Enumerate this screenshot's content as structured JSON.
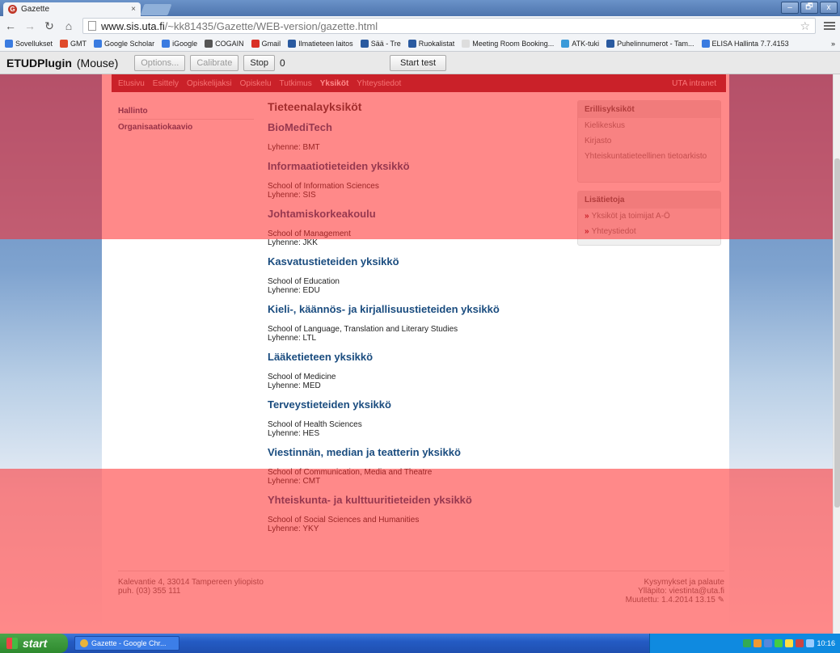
{
  "browser": {
    "tab_title": "Gazette",
    "tab_close": "×",
    "url_host": "www.sis.uta.fi",
    "url_path": "/~kk81435/Gazette/WEB-version/gazette.html",
    "window_controls": [
      "–",
      "🗗",
      "x"
    ]
  },
  "bookmarks": [
    {
      "label": "Sovellukset",
      "color": "#3a7be0"
    },
    {
      "label": "GMT",
      "color": "#e04a2a"
    },
    {
      "label": "Google Scholar",
      "color": "#3a7be0"
    },
    {
      "label": "iGoogle",
      "color": "#3a7be0"
    },
    {
      "label": "COGAIN",
      "color": "#555555"
    },
    {
      "label": "Gmail",
      "color": "#d93025"
    },
    {
      "label": "Ilmatieteen laitos",
      "color": "#2a5aa0"
    },
    {
      "label": "Sää - Tre",
      "color": "#2a5aa0"
    },
    {
      "label": "Ruokalistat",
      "color": "#2a5aa0"
    },
    {
      "label": "Meeting Room Booking...",
      "color": "#dddddd"
    },
    {
      "label": "ATK-tuki",
      "color": "#3a9ad9"
    },
    {
      "label": "Puhelinnumerot - Tam...",
      "color": "#2a5aa0"
    },
    {
      "label": "ELISA Hallinta 7.7.4153",
      "color": "#3a7be0"
    }
  ],
  "plugin": {
    "title": "ETUDPlugin",
    "mode": "(Mouse)",
    "options": "Options...",
    "calibrate": "Calibrate",
    "stop": "Stop",
    "count": "0",
    "start": "Start test"
  },
  "site_nav": {
    "items": [
      "Etusivu",
      "Esittely",
      "Opiskelijaksi",
      "Opiskelu",
      "Tutkimus",
      "Yksiköt",
      "Yhteystiedot"
    ],
    "active_index": 5,
    "intranet": "UTA intranet"
  },
  "left_nav": [
    "Hallinto",
    "Organisaatiokaavio"
  ],
  "main": {
    "heading": "Tieteenalayksiköt",
    "units": [
      {
        "name": "BioMediTech",
        "english": "",
        "abbr": "Lyhenne: BMT"
      },
      {
        "name": "Informaatiotieteiden yksikkö",
        "english": "School of Information Sciences",
        "abbr": "Lyhenne: SIS"
      },
      {
        "name": "Johtamiskorkeakoulu",
        "english": "School of Management",
        "abbr": "Lyhenne: JKK"
      },
      {
        "name": "Kasvatustieteiden yksikkö",
        "english": "School of Education",
        "abbr": "Lyhenne: EDU"
      },
      {
        "name": "Kieli-, käännös- ja kirjallisuustieteiden yksikkö",
        "english": "School of Language, Translation and Literary Studies",
        "abbr": "Lyhenne: LTL"
      },
      {
        "name": "Lääketieteen yksikkö",
        "english": "School of Medicine",
        "abbr": "Lyhenne: MED"
      },
      {
        "name": "Terveystieteiden yksikkö",
        "english": "School of Health Sciences",
        "abbr": "Lyhenne: HES"
      },
      {
        "name": "Viestinnän, median ja teatterin yksikkö",
        "english": "School of Communication, Media and Theatre",
        "abbr": "Lyhenne: CMT"
      },
      {
        "name": "Yhteiskunta- ja kulttuuritieteiden yksikkö",
        "english": "School of Social Sciences and Humanities",
        "abbr": "Lyhenne: YKY"
      }
    ]
  },
  "sidebar": {
    "box1_title": "Erillisyksiköt",
    "box1_links": [
      "Kielikeskus",
      "Kirjasto",
      "Yhteiskuntatieteellinen tietoarkisto"
    ],
    "box2_title": "Lisätietoja",
    "box2_links": [
      "Yksiköt ja toimijat A-Ö",
      "Yhteystiedot"
    ]
  },
  "footer": {
    "address": "Kalevantie 4, 33014 Tampereen yliopisto",
    "phone": "puh. (03) 355 111",
    "feedback": "Kysymykset ja palaute",
    "maintainer": "Ylläpito: viestinta@uta.fi",
    "modified": "Muutettu: 1.4.2014 13.15"
  },
  "taskbar": {
    "start": "start",
    "window": "Gazette - Google Chr...",
    "time": "10:16"
  }
}
